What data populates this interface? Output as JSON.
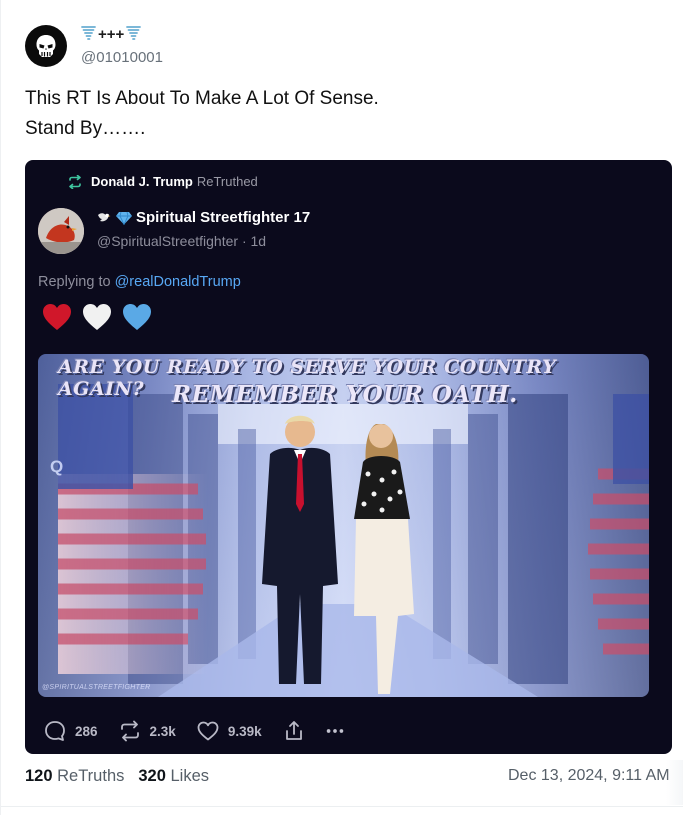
{
  "post": {
    "display_name": "+++",
    "display_name_icons": [
      "tornado-icon",
      "tornado-icon"
    ],
    "handle": "@01010001",
    "text_line1": "This RT Is About To Make A Lot Of Sense.",
    "text_line2": "Stand By…….",
    "retruths_count": "120",
    "retruths_label": "ReTruths",
    "likes_count": "320",
    "likes_label": "Likes",
    "timestamp": "Dec 13, 2024, 9:11 AM"
  },
  "retruth": {
    "by_name": "Donald J. Trump",
    "label": "ReTruthed",
    "author_name": "Spiritual Streetfighter 17",
    "author_meta": "@SpiritualStreetfighter · 1d",
    "replying_prefix": "Replying to ",
    "replying_mention": "@realDonaldTrump",
    "hearts": [
      "red-heart",
      "white-heart",
      "blue-heart"
    ],
    "media": {
      "line1": "ARE YOU READY TO SERVE YOUR COUNTRY AGAIN?",
      "line2": "REMEMBER YOUR OATH.",
      "corner_mark": "Q",
      "watermark": "@SPIRITUALSTREETFIGHTER"
    },
    "actions": {
      "replies": "286",
      "retruths": "2.3k",
      "likes": "9.39k"
    }
  },
  "colors": {
    "card_bg": "#0b0a1c",
    "mention": "#58a8f4",
    "retruth_icon": "#3fc6a0",
    "heart_red": "#d0172a",
    "heart_blue": "#5aa9e6"
  }
}
